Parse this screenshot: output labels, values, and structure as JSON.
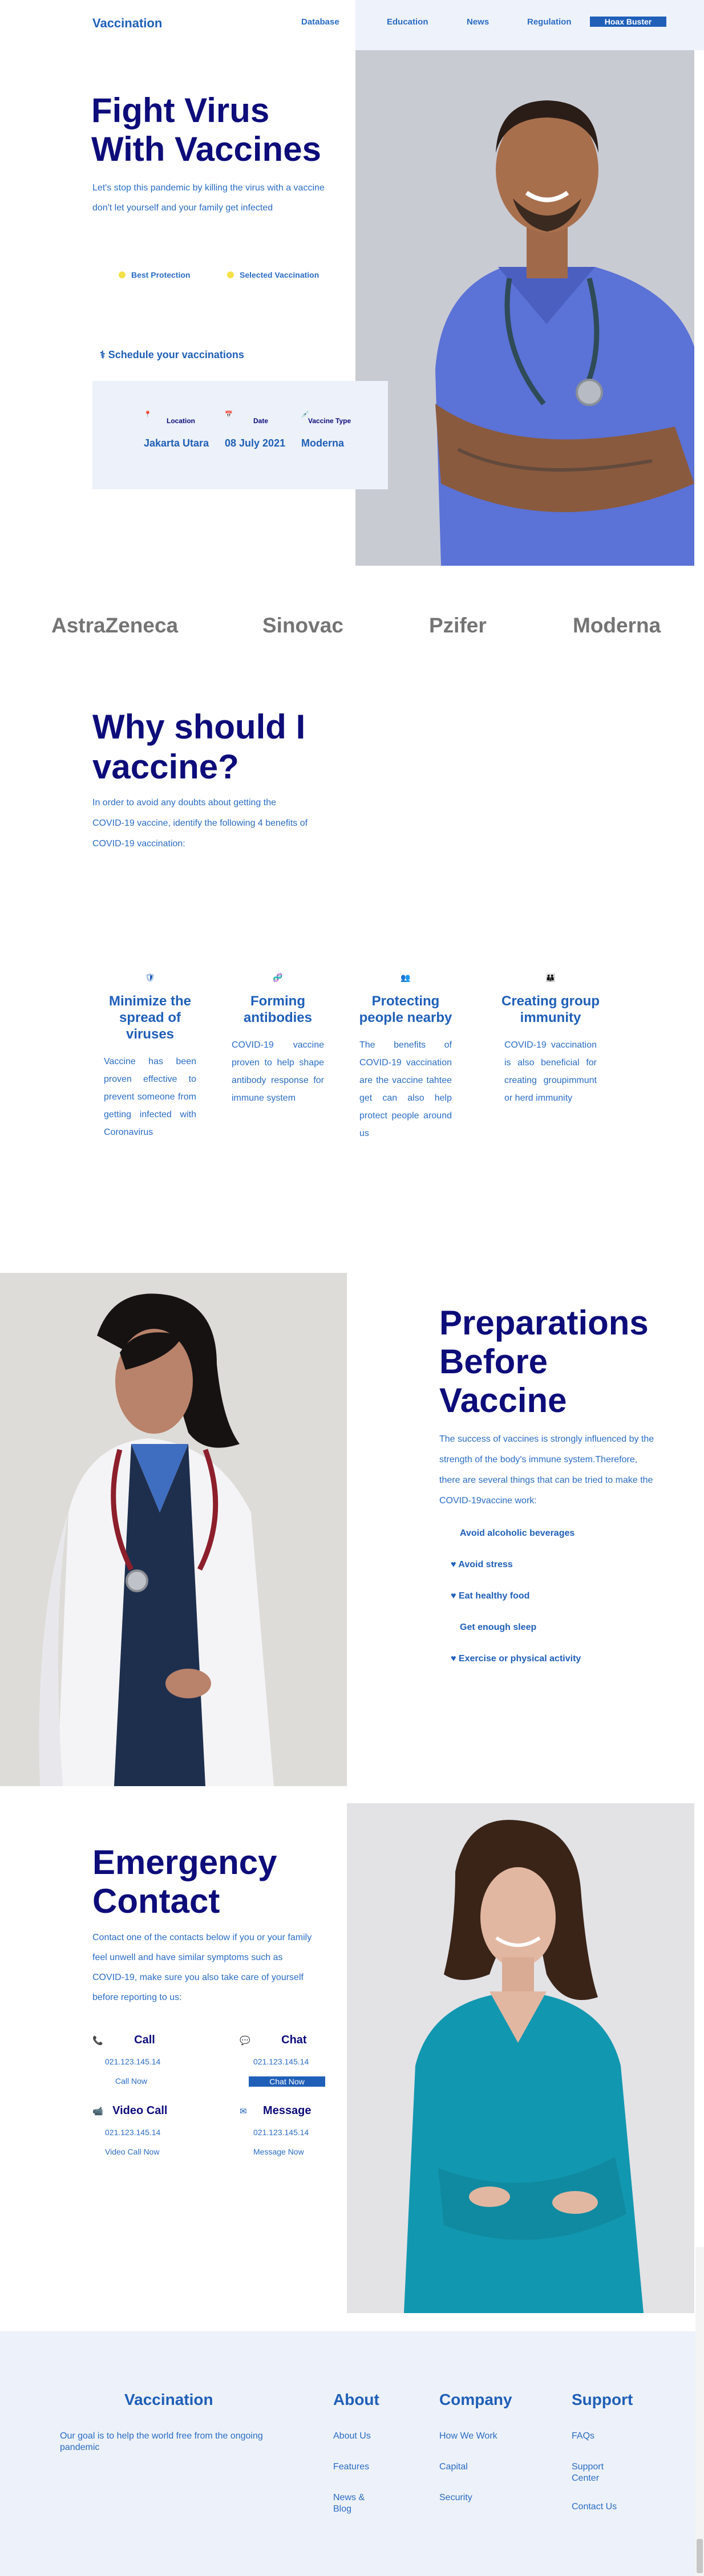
{
  "header": {
    "logo": "Vaccination",
    "nav": [
      "Database",
      "Education",
      "News",
      "Regulation"
    ],
    "cta": "Hoax Buster"
  },
  "hero": {
    "title": "Fight Virus With Vaccines",
    "description": "Let's stop this pandemic by killing the virus with a vaccine don't let yourself and your family get infected",
    "features": [
      "Best Protection",
      "Selected Vaccination"
    ],
    "schedule_title": "Schedule your vaccinations",
    "schedule": [
      {
        "label": "Location",
        "value": "Jakarta Utara"
      },
      {
        "label": "Date",
        "value": "08 July 2021"
      },
      {
        "label": "Vaccine Type",
        "value": "Moderna"
      }
    ]
  },
  "brands": [
    "AstraZeneca",
    "Sinovac",
    "Pzifer",
    "Moderna"
  ],
  "why": {
    "title": "Why should I vaccine?",
    "description": "In order to avoid any doubts about getting the COVID-19 vaccine, identify the following 4 benefits of COVID-19 vaccination:",
    "benefits": [
      {
        "title": "Minimize the spread of viruses",
        "text": "Vaccine has been proven effective to prevent someone from getting infected with Coronavirus"
      },
      {
        "title": "Forming antibodies",
        "text": "COVID-19 vaccine proven to help shape antibody response for immune system"
      },
      {
        "title": "Protecting people nearby",
        "text": "The benefits of COVID-19 vaccination are the vaccine tahtee get can also help protect people around us"
      },
      {
        "title": "Creating group immunity",
        "text": "COVID-19 vaccination is also beneficial for creating groupimmunt or herd immunity"
      }
    ]
  },
  "prep": {
    "title": "Preparations Before Vaccine",
    "description": "The success of vaccines is strongly influenced by the strength of the body's immune system.Therefore, there are several things that can be tried to make the COVID-19vaccine work:",
    "items": [
      "Avoid alcoholic beverages",
      "Avoid stress",
      "Eat healthy food",
      "Get enough sleep",
      "Exercise or physical activity"
    ]
  },
  "emergency": {
    "title": "Emergency Contact",
    "description": "Contact one of the contacts below if you or your family feel unwell and have similar symptoms such as COVID-19, make sure you also take care of yourself before reporting to us:",
    "contacts": [
      {
        "title": "Call",
        "number": "021.123.145.14",
        "button": "Call Now"
      },
      {
        "title": "Chat",
        "number": "021.123.145.14",
        "button": "Chat Now"
      },
      {
        "title": "Video Call",
        "number": "021.123.145.14",
        "button": "Video Call Now"
      },
      {
        "title": "Message",
        "number": "021.123.145.14",
        "button": "Message Now"
      }
    ]
  },
  "footer": {
    "logo": "Vaccination",
    "description": "Our goal is to help the world free from the ongoing pandemic",
    "columns": [
      {
        "title": "About",
        "links": [
          "About Us",
          "Features",
          "News & Blog"
        ]
      },
      {
        "title": "Company",
        "links": [
          "How We Work",
          "Capital",
          "Security"
        ]
      },
      {
        "title": "Support",
        "links": [
          "FAQs",
          "Support Center",
          "Contact Us"
        ]
      }
    ]
  },
  "colors": {
    "navy": "#0d0c7a",
    "blue": "#1f5fb8",
    "panel": "#edf1f9",
    "accent_dot": "#f4e14a"
  }
}
